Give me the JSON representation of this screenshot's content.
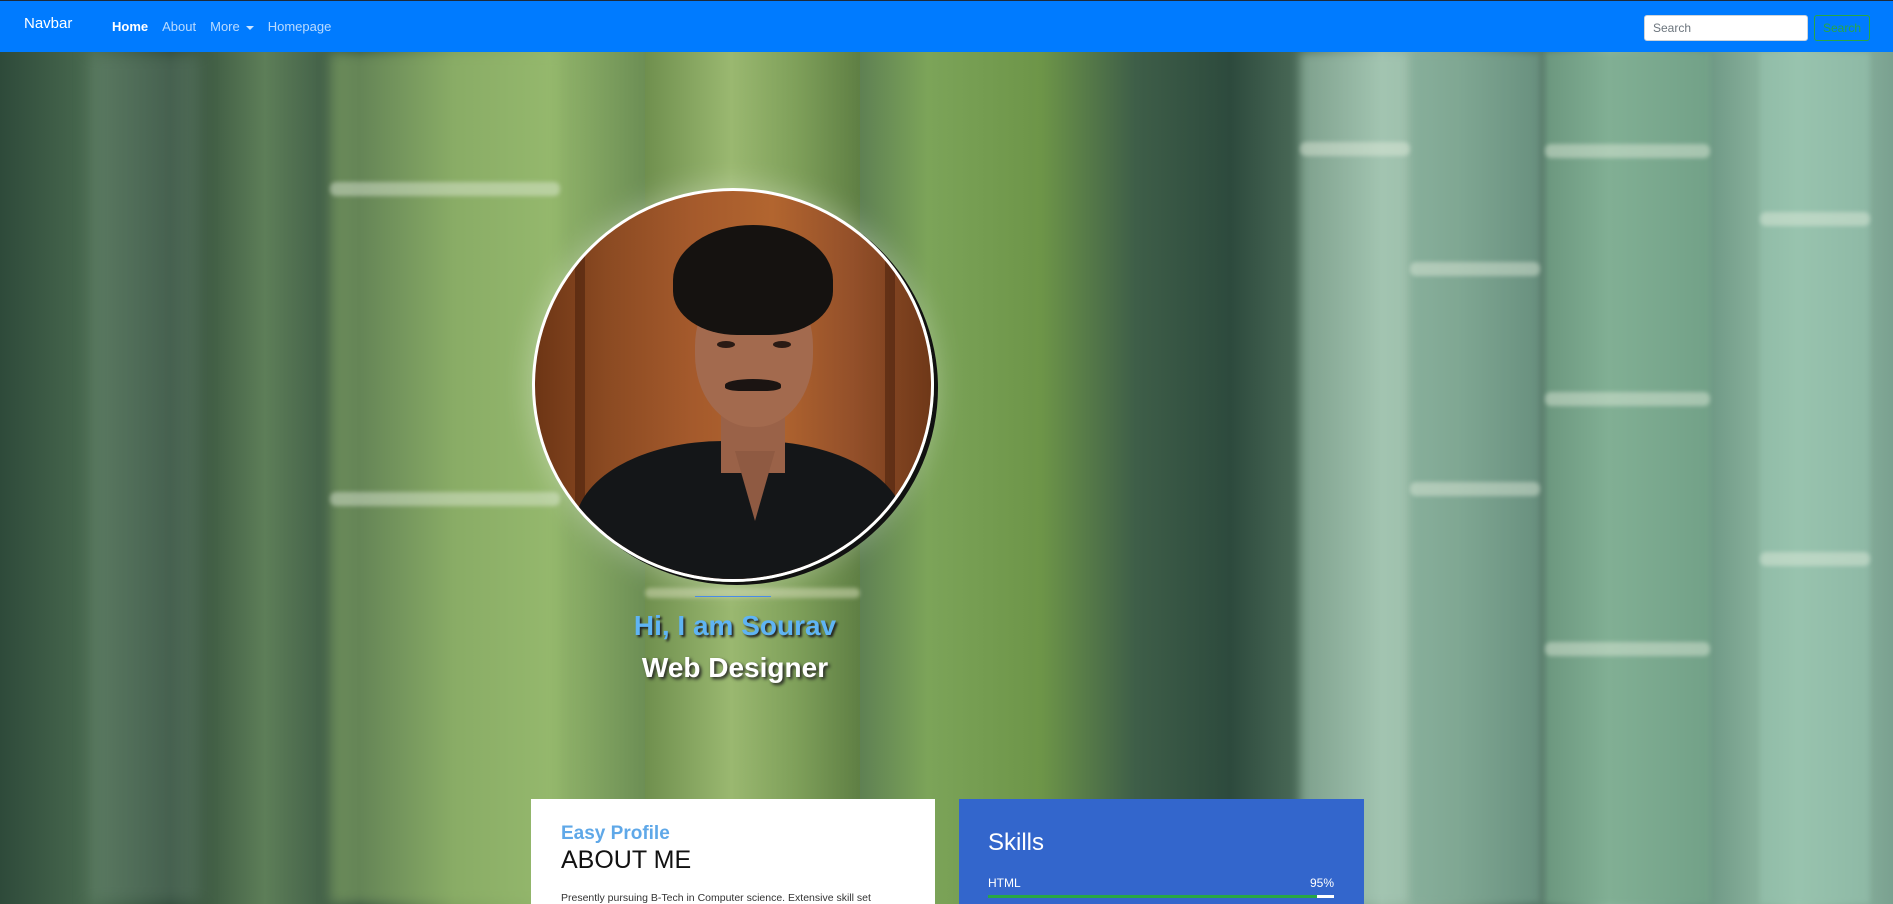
{
  "navbar": {
    "brand": "Navbar",
    "links": [
      {
        "label": "Home",
        "active": true
      },
      {
        "label": "About",
        "active": false
      },
      {
        "label": "More",
        "active": false,
        "dropdown": true
      },
      {
        "label": "Homepage",
        "active": false
      }
    ],
    "search": {
      "placeholder": "Search",
      "button_label": "Search"
    }
  },
  "hero": {
    "greeting": "Hi, I am Sourav",
    "role": "Web Designer"
  },
  "about": {
    "kicker": "Easy Profile",
    "title": "ABOUT ME",
    "text": "Presently pursuing B-Tech in Computer science. Extensive skill set"
  },
  "skills": {
    "title": "Skills",
    "items": [
      {
        "name": "HTML",
        "percent_label": "95%",
        "percent": 95
      }
    ]
  },
  "colors": {
    "navbar": "#007bff",
    "accent_blue": "#5fb4f4",
    "skills_card": "#3366cc",
    "progress": "#28a745"
  }
}
